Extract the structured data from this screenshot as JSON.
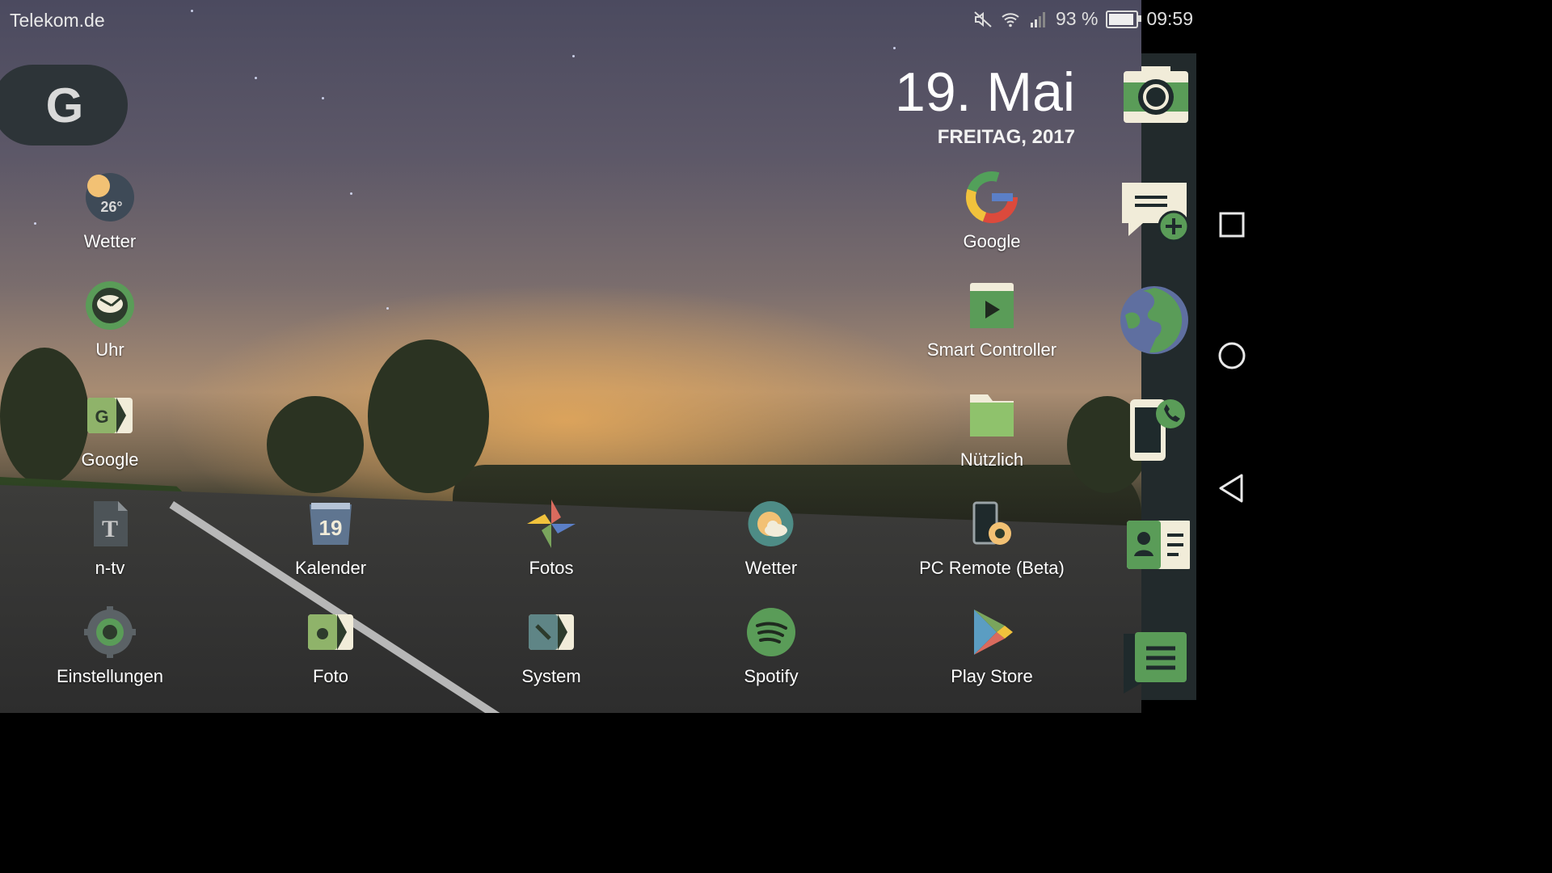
{
  "status_bar": {
    "carrier": "Telekom.de",
    "battery_percent": "93 %",
    "battery_level": 0.93,
    "time": "09:59",
    "icons": [
      "mute-icon",
      "wifi-icon",
      "signal-icon",
      "battery-icon"
    ]
  },
  "search_widget": {
    "letter": "G"
  },
  "date_widget": {
    "date": "19. Mai",
    "weekday_year": "FREITAG, 2017"
  },
  "apps": {
    "wetter_top": {
      "label": "Wetter",
      "temp": "26°"
    },
    "uhr": {
      "label": "Uhr"
    },
    "google_folder": {
      "label": "Google",
      "letter": "G"
    },
    "ntv": {
      "label": "n-tv"
    },
    "einstellungen": {
      "label": "Einstellungen"
    },
    "google_app": {
      "label": "Google"
    },
    "smart_controller": {
      "label": "Smart Controller"
    },
    "nuetzlich": {
      "label": "Nützlich"
    },
    "kalender": {
      "label": "Kalender",
      "day": "19"
    },
    "fotos": {
      "label": "Fotos"
    },
    "wetter_bottom": {
      "label": "Wetter"
    },
    "pc_remote": {
      "label": "PC Remote (Beta)"
    },
    "foto": {
      "label": "Foto"
    },
    "system": {
      "label": "System"
    },
    "spotify": {
      "label": "Spotify"
    },
    "play_store": {
      "label": "Play Store"
    }
  },
  "dock": {
    "items": [
      "camera-icon",
      "new-message-icon",
      "browser-globe-icon",
      "phone-icon",
      "contacts-icon",
      "app-drawer-icon"
    ]
  },
  "navigation": {
    "buttons": [
      "recents-button",
      "home-button",
      "back-button"
    ]
  },
  "colors": {
    "dock_bg": "#222a2c",
    "icon_green": "#5a9c58",
    "icon_cream": "#f1ecd9"
  }
}
